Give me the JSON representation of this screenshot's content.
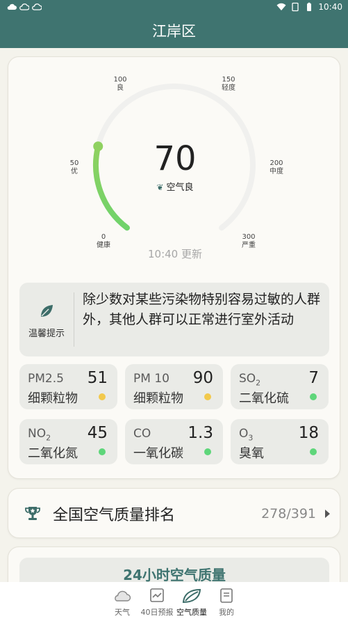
{
  "status_bar": {
    "time": "10:40",
    "icons": [
      "cloud-icon",
      "cloud-icon",
      "cloud-icon",
      "wifi-icon",
      "sim-icon",
      "battery-icon"
    ]
  },
  "header": {
    "title": "江岸区"
  },
  "aqi": {
    "value": "70",
    "level": "空气良",
    "update_time": "10:40 更新",
    "gauge_fraction": 0.2333,
    "gauge_colors": {
      "track": "#f0f0ee",
      "start": "#6fd36b",
      "end": "#8fd160"
    },
    "ticks": [
      {
        "value": "0",
        "label": "健康"
      },
      {
        "value": "50",
        "label": "优"
      },
      {
        "value": "100",
        "label": "良"
      },
      {
        "value": "150",
        "label": "轻度"
      },
      {
        "value": "200",
        "label": "中度"
      },
      {
        "value": "300",
        "label": "严重"
      }
    ]
  },
  "tip": {
    "label": "温馨提示",
    "text": "除少数对某些污染物特别容易过敏的人群外，其他人群可以正常进行室外活动"
  },
  "pollutants": [
    {
      "name": "PM2.5",
      "sub": "",
      "value": "51",
      "desc": "细颗粒物",
      "dot_color": "#f2c94c"
    },
    {
      "name": "PM 10",
      "sub": "",
      "value": "90",
      "desc": "细颗粒物",
      "dot_color": "#f2c94c"
    },
    {
      "name": "SO",
      "sub": "2",
      "value": "7",
      "desc": "二氧化硫",
      "dot_color": "#5ed67a"
    },
    {
      "name": "NO",
      "sub": "2",
      "value": "45",
      "desc": "二氧化氮",
      "dot_color": "#5ed67a"
    },
    {
      "name": "CO",
      "sub": "",
      "value": "1.3",
      "desc": "一氧化碳",
      "dot_color": "#5ed67a"
    },
    {
      "name": "O",
      "sub": "3",
      "value": "18",
      "desc": "臭氧",
      "dot_color": "#5ed67a"
    }
  ],
  "ranking": {
    "title": "全国空气质量排名",
    "value": "278/391"
  },
  "hourly": {
    "title": "24小时空气质量"
  },
  "bottom_nav": [
    {
      "label": "天气",
      "icon": "weather-cloud-icon",
      "active": false
    },
    {
      "label": "40日预报",
      "icon": "forecast-chart-icon",
      "active": false
    },
    {
      "label": "空气质量",
      "icon": "leaf-icon",
      "active": true
    },
    {
      "label": "我的",
      "icon": "profile-doc-icon",
      "active": false
    }
  ],
  "colors": {
    "primary": "#3f7470",
    "background": "#f4f3ec",
    "card": "#fbfaf6"
  }
}
